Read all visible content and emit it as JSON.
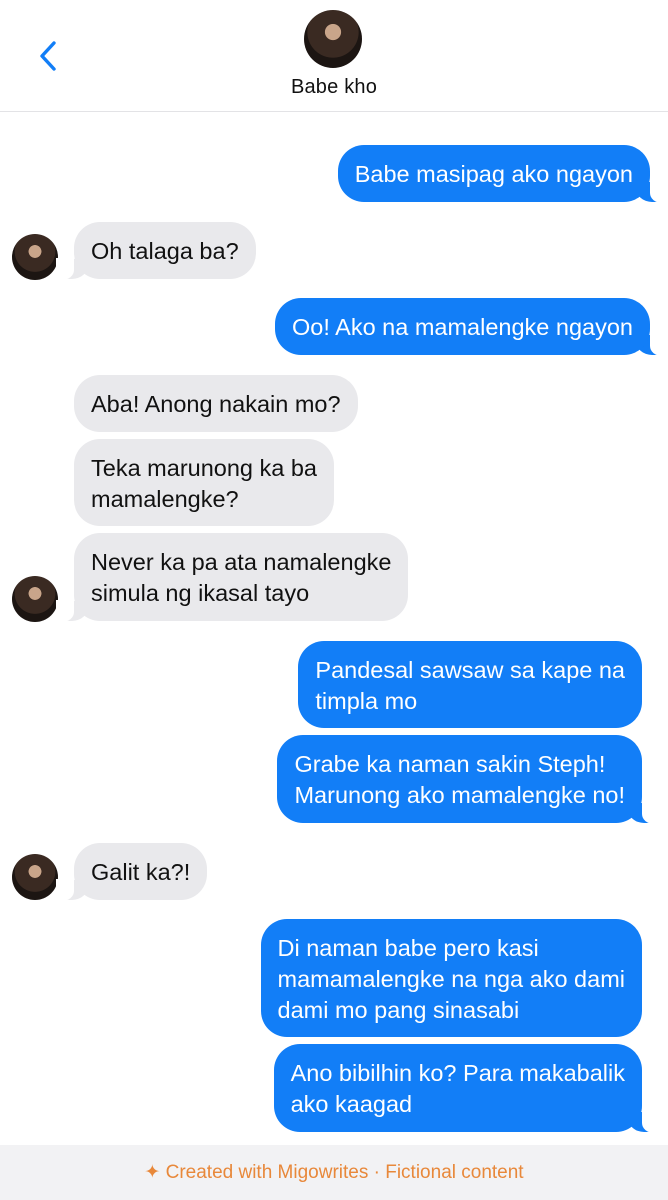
{
  "header": {
    "contact_name": "Babe kho"
  },
  "messages": [
    {
      "sender": "me",
      "text": "Babe masipag ako ngayon"
    },
    {
      "sender": "contact",
      "text": "Oh talaga ba?"
    },
    {
      "sender": "me",
      "text": "Oo! Ako na mamalengke ngayon"
    },
    {
      "sender": "contact",
      "text": "Aba! Anong nakain mo?"
    },
    {
      "sender": "contact",
      "text": "Teka marunong ka ba\nmamalengke?"
    },
    {
      "sender": "contact",
      "text": "Never ka pa ata namalengke\nsimula ng ikasal tayo"
    },
    {
      "sender": "me",
      "text": "Pandesal sawsaw sa kape na\ntimpla mo"
    },
    {
      "sender": "me",
      "text": "Grabe ka naman sakin Steph!\nMarunong ako mamalengke no!"
    },
    {
      "sender": "contact",
      "text": "Galit ka?!"
    },
    {
      "sender": "me",
      "text": "Di naman babe pero kasi\nmamamalengke na nga ako dami\ndami mo pang sinasabi"
    },
    {
      "sender": "me",
      "text": "Ano bibilhin ko? Para makabalik\nako kaagad"
    }
  ],
  "footer": {
    "text": "✦ Created with Migowrites · Fictional content"
  },
  "colors": {
    "outgoing_bubble": "#127ef7",
    "incoming_bubble": "#e9e9ec",
    "accent": "#127ef7",
    "footer_text": "#e8883a"
  },
  "icons": {
    "back": "chevron-left-icon"
  }
}
